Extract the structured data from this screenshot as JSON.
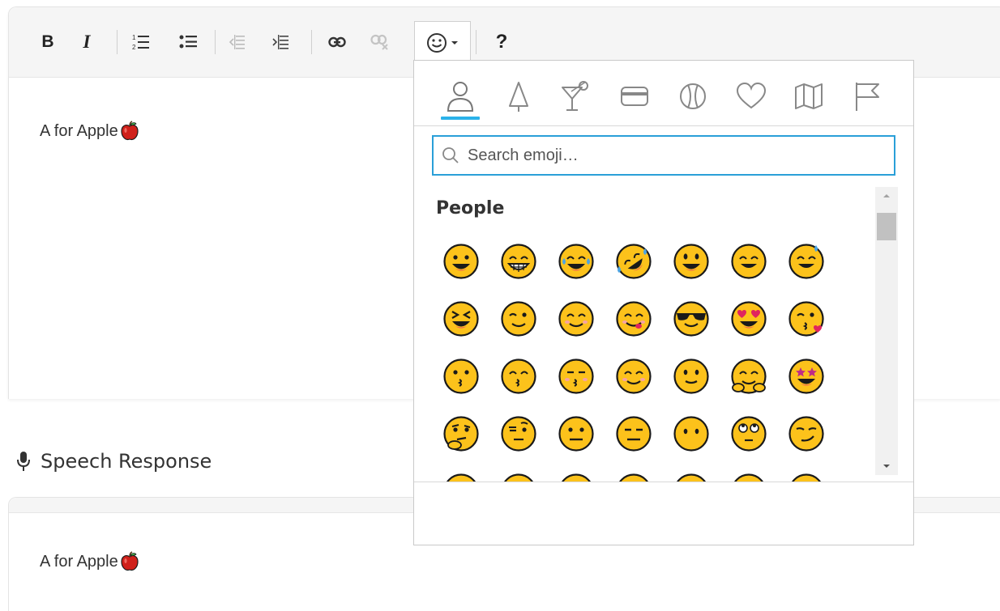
{
  "editor": {
    "text": "A for Apple",
    "toolbar": {
      "bold_label": "B",
      "italic_label": "I",
      "help_label": "?"
    }
  },
  "speech": {
    "label": "Speech Response",
    "text": "A for Apple"
  },
  "emoji_picker": {
    "categories": [
      "people",
      "nature",
      "food-drink",
      "objects",
      "activity",
      "symbols",
      "travel",
      "flags"
    ],
    "active_category": "people",
    "search_placeholder": "Search emoji…",
    "section_title": "People",
    "accent_color": "#2bb2ea",
    "emojis": [
      [
        "grinning",
        "grimacing",
        "joy",
        "rolling-on-floor-laughing",
        "smiley",
        "smile",
        "sweat-smile"
      ],
      [
        "laughing",
        "wink",
        "blush",
        "yum",
        "sunglasses",
        "heart-eyes",
        "kissing-heart"
      ],
      [
        "kissing",
        "kissing-smiling-eyes",
        "kissing-closed-eyes",
        "relaxed",
        "slightly-smiling",
        "hugging",
        "star-struck"
      ],
      [
        "thinking",
        "raised-eyebrow",
        "neutral",
        "expressionless",
        "no-mouth",
        "rolling-eyes",
        "smirk"
      ]
    ]
  }
}
